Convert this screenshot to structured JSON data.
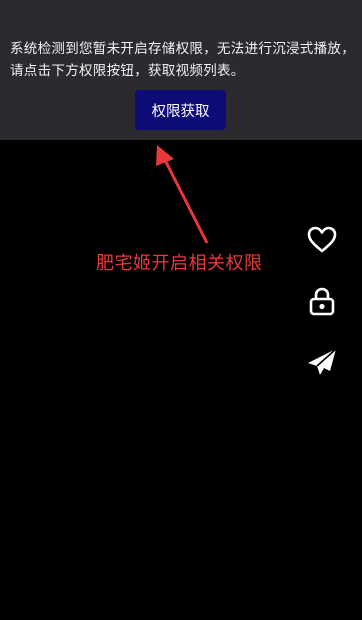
{
  "permission_notice": {
    "message": "系统检测到您暂未开启存储权限，无法进行沉浸式播放，请点击下方权限按钮，获取视频列表。",
    "button_label": "权限获取"
  },
  "annotation": {
    "text": "肥宅姬开启相关权限",
    "color": "#e8383a"
  },
  "side_actions": [
    {
      "icon": "heart-icon",
      "label": "like"
    },
    {
      "icon": "lock-icon",
      "label": "lock"
    },
    {
      "icon": "paper-plane-icon",
      "label": "share"
    }
  ],
  "colors": {
    "panel_background": "#2b2b2f",
    "button_background": "#0d0b78",
    "screen_background": "#000000"
  }
}
